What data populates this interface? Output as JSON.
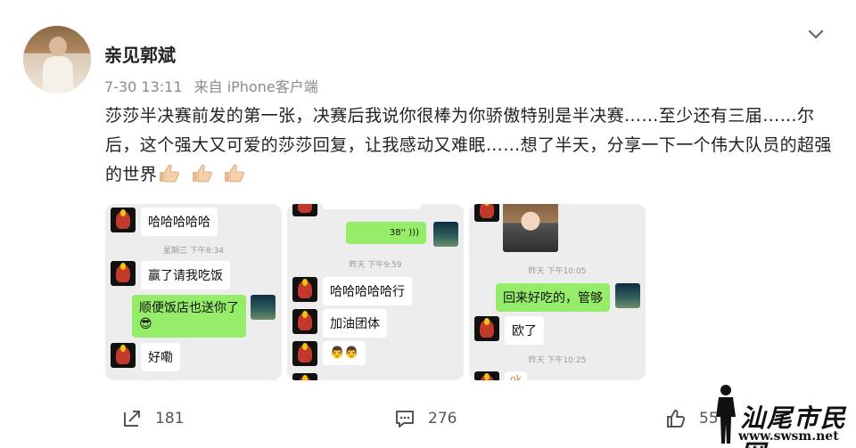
{
  "post": {
    "username": "亲见郭斌",
    "time": "7-30 13:11",
    "source": "来自 iPhone客户端",
    "text": "莎莎半决赛前发的第一张，决赛后我说你很棒为你骄傲特别是半决赛……至少还有三届……尔后，这个强大又可爱的莎莎回复，让我感动又难眠……想了半天，分享一下一个伟大队员的超强的世界"
  },
  "images": {
    "shot1": {
      "msg1": "哈哈哈哈哈",
      "time1": "星期三 下午8:34",
      "msg2": "赢了请我吃饭",
      "msg3_line1": "顺便饭店也送你了",
      "msg3_emoji": "😎",
      "msg4": "好嘞"
    },
    "shot2": {
      "voice": "38''",
      "time1": "昨天 下午9:59",
      "msg1": "哈哈哈哈哈行",
      "msg2": "加油团体",
      "msg3": "👨‍👨"
    },
    "shot3": {
      "time1": "昨天 下午10:05",
      "msg1": "回来好吃的，管够",
      "msg2": "欧了",
      "time2": "昨天 下午10:25",
      "msg3": "ok"
    }
  },
  "footer": {
    "reposts": "181",
    "comments": "276",
    "likes": "55"
  },
  "watermark": {
    "name": "汕尾市民网",
    "url": "www.swsm.net"
  },
  "icons": {
    "more": "chevron-down-icon",
    "repost": "repost-icon",
    "comment": "comment-icon",
    "like": "thumbs-up-icon"
  }
}
